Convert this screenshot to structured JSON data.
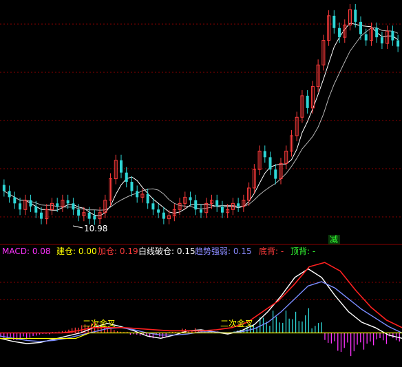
{
  "colors": {
    "up": "#ff3b3b",
    "down": "#2ed6d6",
    "ma_short": "#ffffff",
    "ma_long": "#b4b4b4",
    "grid": "#8b0000",
    "macd_white": "#ffffff",
    "macd_red": "#ff2020",
    "macd_blue": "#7a8cff",
    "macd_yellow": "#ffff00",
    "hist_pos": "#ff3b3b",
    "hist_neg": "#ff33ff",
    "hist_teal": "#2ed6d6",
    "label_macd": "#ff33ff",
    "label_jiancang": "#ffff00",
    "label_jiacang": "#ff3b3b",
    "label_white": "#ffffff",
    "label_trend": "#8a8aff",
    "label_dibei": "#ff3b3b",
    "label_dingbei": "#33ff33"
  },
  "price_panel": {
    "low_marker": "10.98"
  },
  "indicator_panel": {
    "macd_label": "MACD:",
    "macd_value": "0.08",
    "jiancang_label": "建仓:",
    "jiancang_value": "0.00",
    "jiacang_label": "加仓:",
    "jiacang_value": "0.19",
    "white_line_label": "白线破仓:",
    "white_line_value": "0.15",
    "trend_label": "趋势强弱:",
    "trend_value": "0.15",
    "dibei_label": "底背:",
    "dibei_value": "-",
    "dingbei_label": "顶背:",
    "dingbei_value": "-",
    "jian_badge": "减",
    "annotations": [
      "二次金叉",
      "二次金叉"
    ]
  },
  "chart_data": [
    {
      "type": "candlestick",
      "title": "",
      "annotations": [
        "10.98"
      ],
      "closes": [
        11.9,
        11.7,
        11.5,
        11.3,
        11.6,
        11.4,
        11.2,
        11.0,
        11.3,
        11.5,
        11.4,
        11.6,
        11.5,
        11.3,
        11.1,
        11.2,
        11.0,
        10.98,
        11.2,
        11.6,
        12.3,
        12.9,
        12.5,
        12.2,
        11.9,
        11.7,
        11.8,
        11.5,
        11.3,
        11.2,
        11.0,
        11.1,
        11.3,
        11.5,
        11.7,
        11.6,
        11.3,
        11.2,
        11.5,
        11.6,
        11.4,
        11.2,
        11.3,
        11.5,
        11.4,
        11.6,
        12.0,
        12.6,
        13.2,
        13.0,
        12.6,
        12.3,
        12.8,
        13.2,
        13.7,
        14.3,
        15.0,
        14.6,
        15.3,
        16.0,
        16.8,
        17.6,
        17.2,
        16.9,
        17.3,
        17.8,
        17.4,
        17.0,
        16.8,
        17.2,
        16.9,
        16.7,
        17.1,
        16.8,
        16.6
      ],
      "opens": [
        12.1,
        11.9,
        11.7,
        11.5,
        11.3,
        11.6,
        11.4,
        11.2,
        11.0,
        11.3,
        11.5,
        11.4,
        11.6,
        11.5,
        11.3,
        11.1,
        11.2,
        11.1,
        11.0,
        11.2,
        11.6,
        12.3,
        12.9,
        12.5,
        12.2,
        11.9,
        11.7,
        11.8,
        11.5,
        11.3,
        11.2,
        11.0,
        11.1,
        11.3,
        11.5,
        11.7,
        11.6,
        11.3,
        11.2,
        11.5,
        11.6,
        11.4,
        11.2,
        11.3,
        11.5,
        11.4,
        11.6,
        12.0,
        12.6,
        13.2,
        13.0,
        12.6,
        12.3,
        12.8,
        13.2,
        13.7,
        14.3,
        15.0,
        14.6,
        15.3,
        16.0,
        16.8,
        17.6,
        17.2,
        16.9,
        17.3,
        17.8,
        17.4,
        17.0,
        16.8,
        17.2,
        16.9,
        16.7,
        17.1,
        16.8
      ],
      "ylim": [
        10.5,
        18.0
      ]
    },
    {
      "type": "line",
      "title": "",
      "series": [
        {
          "values": [
            -0.05,
            -0.08,
            -0.1,
            -0.09,
            -0.06,
            -0.03,
            0.0,
            0.05,
            0.09,
            0.06,
            0.02,
            -0.03,
            -0.05,
            -0.02,
            0.02,
            0.03,
            0.01,
            -0.01,
            0.02,
            0.08,
            0.2,
            0.35,
            0.52,
            0.6,
            0.52,
            0.35,
            0.2,
            0.1,
            0.05,
            -0.02,
            -0.05
          ]
        },
        {
          "values": [
            -0.03,
            -0.05,
            -0.07,
            -0.08,
            -0.07,
            -0.05,
            -0.02,
            0.01,
            0.04,
            0.05,
            0.03,
            0.0,
            -0.02,
            -0.02,
            -0.01,
            0.01,
            0.01,
            0.0,
            0.01,
            0.04,
            0.1,
            0.2,
            0.32,
            0.44,
            0.48,
            0.42,
            0.32,
            0.22,
            0.14,
            0.06,
            0.0
          ]
        },
        {
          "values": [
            0.0,
            0.0,
            0.0,
            0.0,
            0.0,
            0.02,
            0.05,
            0.05,
            0.05,
            0.04,
            0.03,
            0.02,
            0.02,
            0.02,
            0.03,
            0.05,
            0.1,
            0.2,
            0.3,
            0.45,
            0.62,
            0.66,
            0.58,
            0.4,
            0.24,
            0.12,
            0.05
          ]
        }
      ],
      "histogram": [
        -0.05,
        -0.07,
        -0.06,
        -0.02,
        0.02,
        0.05,
        0.08,
        0.1,
        0.07,
        0.02,
        -0.03,
        -0.05,
        -0.04,
        0.01,
        0.04,
        0.05,
        0.02,
        -0.01,
        0.03,
        0.08,
        0.15,
        0.22,
        0.3,
        0.25,
        0.1,
        -0.1,
        -0.18,
        -0.22,
        -0.2,
        -0.12,
        -0.08
      ],
      "ylim": [
        -0.3,
        0.7
      ]
    }
  ]
}
